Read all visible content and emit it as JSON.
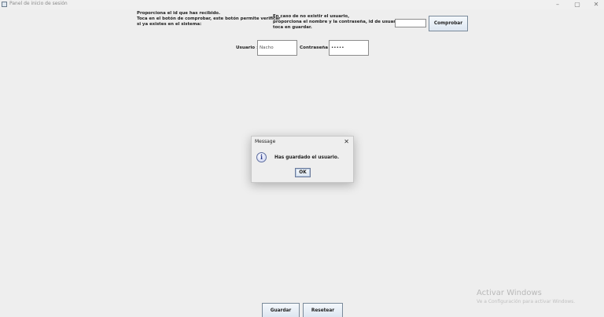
{
  "window": {
    "title": "Panel de inicio de sesión",
    "minimize_glyph": "–",
    "maximize_glyph": "▢",
    "close_glyph": "✕"
  },
  "instructions": {
    "left": [
      "Proporciona el id que has recibido.",
      "Toca en el botón de comprobar, este botón permite verificar",
      "si ya existes en el sistema:"
    ],
    "right": [
      "En caso de no existir el usuario,",
      "proporciona el nombre y la contraseña, id de usuario:",
      "toca en guardar."
    ]
  },
  "id_input": {
    "value": ""
  },
  "check_button": {
    "label": "Comprobar"
  },
  "form": {
    "user_label": "Usuario :",
    "user_value": "Nacho",
    "password_label": "Contraseña :",
    "password_value": "•••••"
  },
  "dialog": {
    "title": "Message",
    "close_glyph": "✕",
    "icon_glyph": "i",
    "message": "Has guardado el usuario.",
    "ok_label": "OK"
  },
  "bottom_buttons": {
    "save_label": "Guardar",
    "reset_label": "Resetear"
  },
  "watermark": {
    "title": "Activar Windows",
    "subtitle": "Ve a Configuración para activar Windows."
  }
}
